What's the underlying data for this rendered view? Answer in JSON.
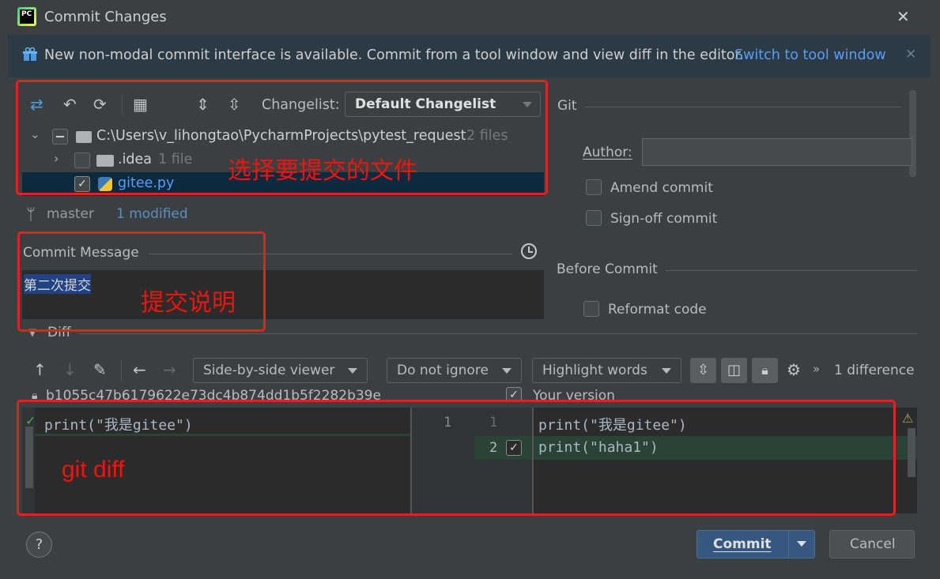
{
  "title_bar": {
    "title": "Commit Changes",
    "app_icon": "PC",
    "close": "✕"
  },
  "banner": {
    "text": "New non-modal commit interface is available. Commit from a tool window and view diff in the editor.",
    "link": "Switch to tool window",
    "close": "✕"
  },
  "toolbar": {
    "changelist_label": "Changelist:",
    "changelist_value": "Default Changelist"
  },
  "tree": {
    "root_path": "C:\\Users\\v_lihongtao\\PycharmProjects\\pytest_request",
    "root_count": "2 files",
    "idea_name": ".idea",
    "idea_count": "1 file",
    "file_name": "gitee.py"
  },
  "status": {
    "branch": "master",
    "modified": "1 modified"
  },
  "commit_message": {
    "label": "Commit Message",
    "value": "第二次提交"
  },
  "right_panel": {
    "git_label": "Git",
    "author_label": "Author:",
    "author_value": "",
    "amend": "Amend commit",
    "signoff": "Sign-off commit",
    "before_commit": "Before Commit",
    "reformat": "Reformat code"
  },
  "diff": {
    "section": "Diff",
    "viewer": "Side-by-side viewer",
    "ignore": "Do not ignore",
    "highlight": "Highlight words",
    "differences": "1 difference",
    "left_hash": "b1055c47b6179622e73dc4b874dd1b5f2282b39e",
    "right_title": "Your version",
    "left_line1": "print(\"我是gitee\")",
    "ln_left_1": "1",
    "ln_right_1": "1",
    "ln_right_2": "2",
    "right_line1": "print(\"我是gitee\")",
    "right_line2": "print(\"haha1\")"
  },
  "annotations": {
    "select_files": "选择要提交的文件",
    "commit_desc": "提交说明",
    "git_diff": "git diff"
  },
  "footer": {
    "help": "?",
    "commit": "Commit",
    "cancel": "Cancel"
  },
  "colors": {
    "accent": "#589df6",
    "annotation_red": "#e7211a",
    "diff_added": "#294436"
  }
}
